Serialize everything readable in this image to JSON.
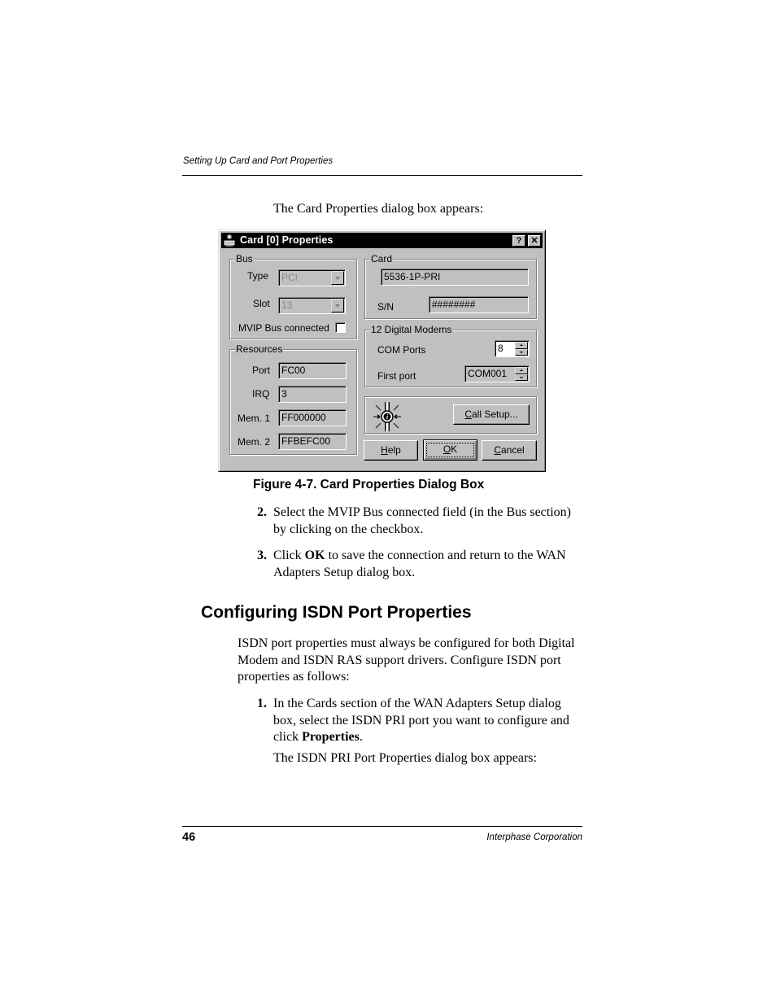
{
  "page": {
    "running_header": "Setting Up Card and Port Properties",
    "intro": "The Card Properties dialog box appears:",
    "figure_caption": "Figure 4-7.  Card Properties Dialog Box",
    "steps_a": [
      {
        "num": "2.",
        "text": "Select the MVIP Bus connected field (in the Bus section) by clicking on the checkbox."
      },
      {
        "num": "3.",
        "pre": "Click ",
        "bold": "OK",
        "post": " to save the connection and return to the WAN Adapters Setup dialog box."
      }
    ],
    "section_heading": "Configuring ISDN Port Properties",
    "section_para": "ISDN port properties must always be configured for both Digital Modem and ISDN RAS support drivers. Configure ISDN port properties as follows:",
    "steps_b": [
      {
        "num": "1.",
        "pre": "In the Cards section of the WAN Adapters Setup dialog box, select the ISDN PRI port you want to configure and click ",
        "bold": "Properties",
        "post": ".",
        "followup": "The ISDN PRI Port Properties dialog box appears:"
      }
    ],
    "page_number": "46",
    "footer_company": "Interphase Corporation"
  },
  "dialog": {
    "title": "Card [0] Properties",
    "title_icon": "computer-card-icon",
    "help_button": "?",
    "close_button": "✕",
    "bus": {
      "label": "Bus",
      "type_label": "Type",
      "type_value": "PCI",
      "slot_label": "Slot",
      "slot_value": "13",
      "mvip_label": "MVIP Bus connected",
      "mvip_checked": false
    },
    "card": {
      "label": "Card",
      "model": "5536-1P-PRI",
      "sn_label": "S/N",
      "sn_value": "########"
    },
    "modems": {
      "label": "12 Digital Modems",
      "com_ports_label": "COM Ports",
      "com_ports_value": "8",
      "first_port_label": "First port",
      "first_port_value": "COM001"
    },
    "resources": {
      "label": "Resources",
      "port_label": "Port",
      "port_value": "FC00",
      "irq_label": "IRQ",
      "irq_value": "3",
      "mem1_label": "Mem. 1",
      "mem1_value": "FF000000",
      "mem2_label": "Mem. 2",
      "mem2_value": "FFBEFC00"
    },
    "call_setup": {
      "icon": "digital-modem-info-icon",
      "mnemonic": "C",
      "rest": "all Setup..."
    },
    "buttons": {
      "help": {
        "mnemonic": "H",
        "rest": "elp"
      },
      "ok": {
        "mnemonic": "O",
        "rest": "K"
      },
      "cancel": {
        "mnemonic": "C",
        "rest": "ancel"
      }
    }
  }
}
